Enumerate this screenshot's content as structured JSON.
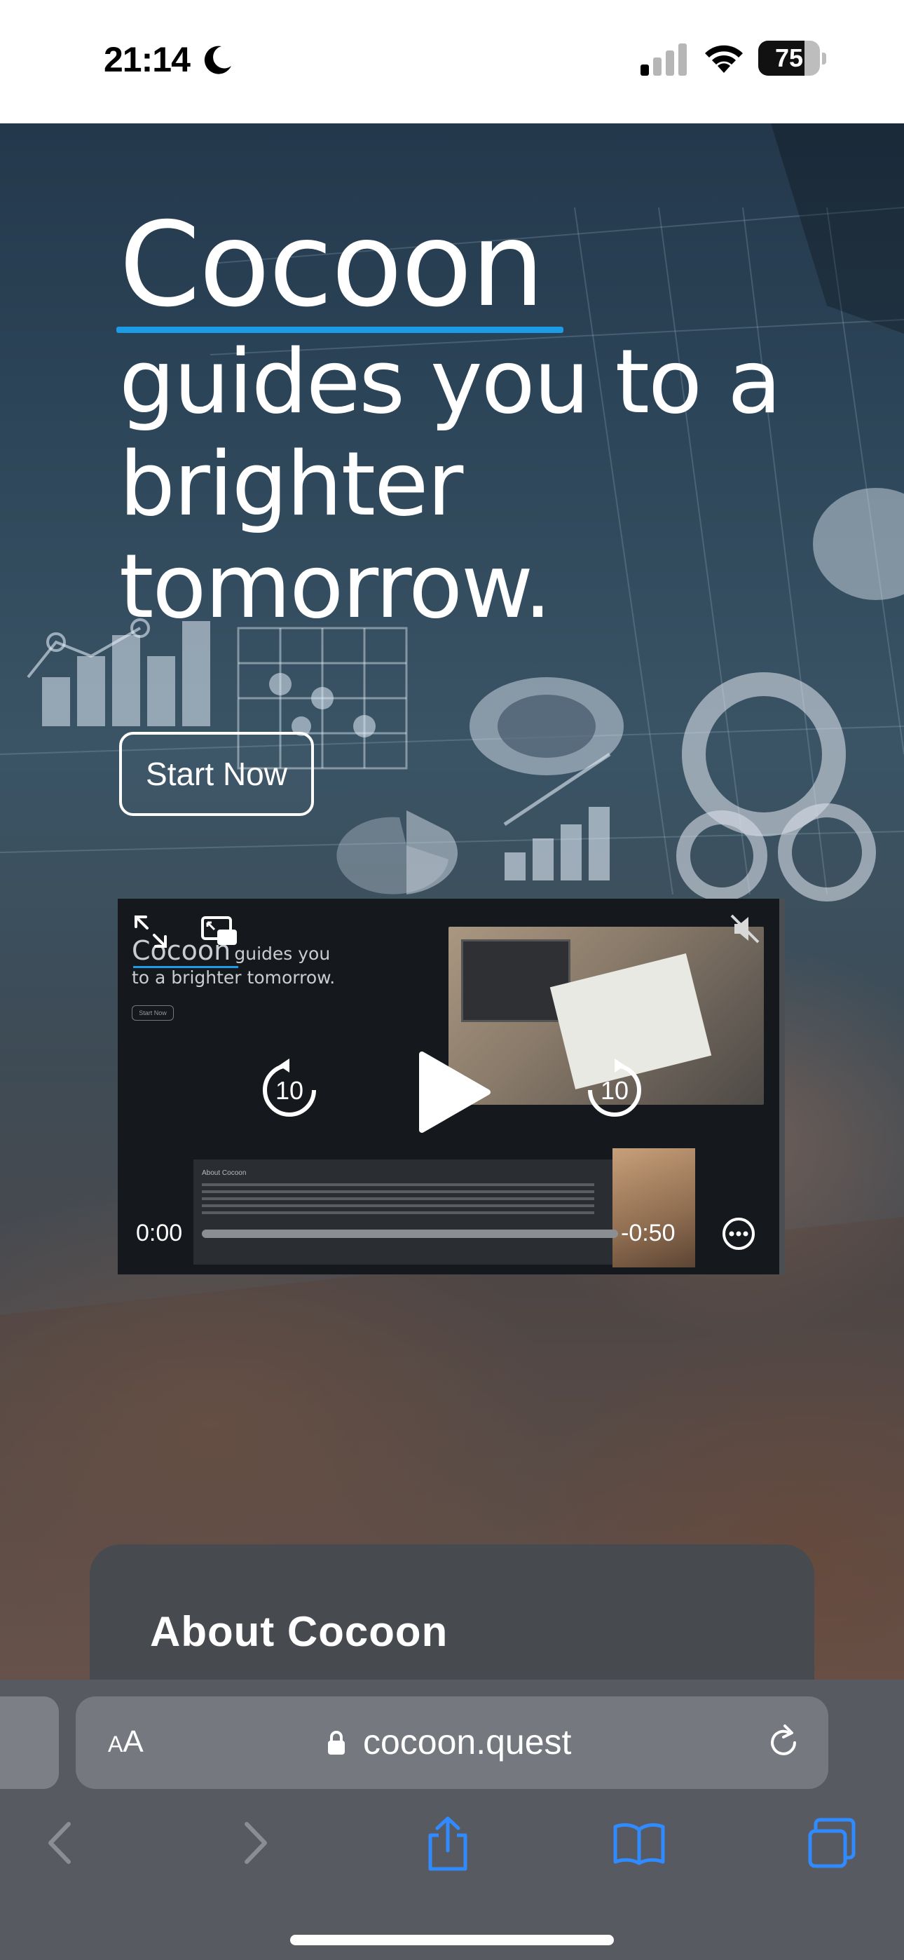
{
  "status_bar": {
    "time": "21:14",
    "battery": "75",
    "battery_level": 0.75
  },
  "hero": {
    "brand": "Cocoon",
    "headline": "guides you to a brighter tomorrow.",
    "cta_label": "Start Now"
  },
  "video": {
    "brand": "Cocoon",
    "title_rest": "guides you",
    "title_line2": "to a brighter tomorrow.",
    "mini_button": "Start Now",
    "about_heading": "About Cocoon",
    "skip_seconds": "10",
    "time_elapsed": "0:00",
    "time_remaining": "-0:50"
  },
  "about": {
    "heading": "About Cocoon"
  },
  "browser": {
    "aa_small": "A",
    "aa_large": "A",
    "url": "cocoon.quest"
  },
  "colors": {
    "accent": "#1c9be6",
    "safari_icon": "#2f8bff"
  }
}
